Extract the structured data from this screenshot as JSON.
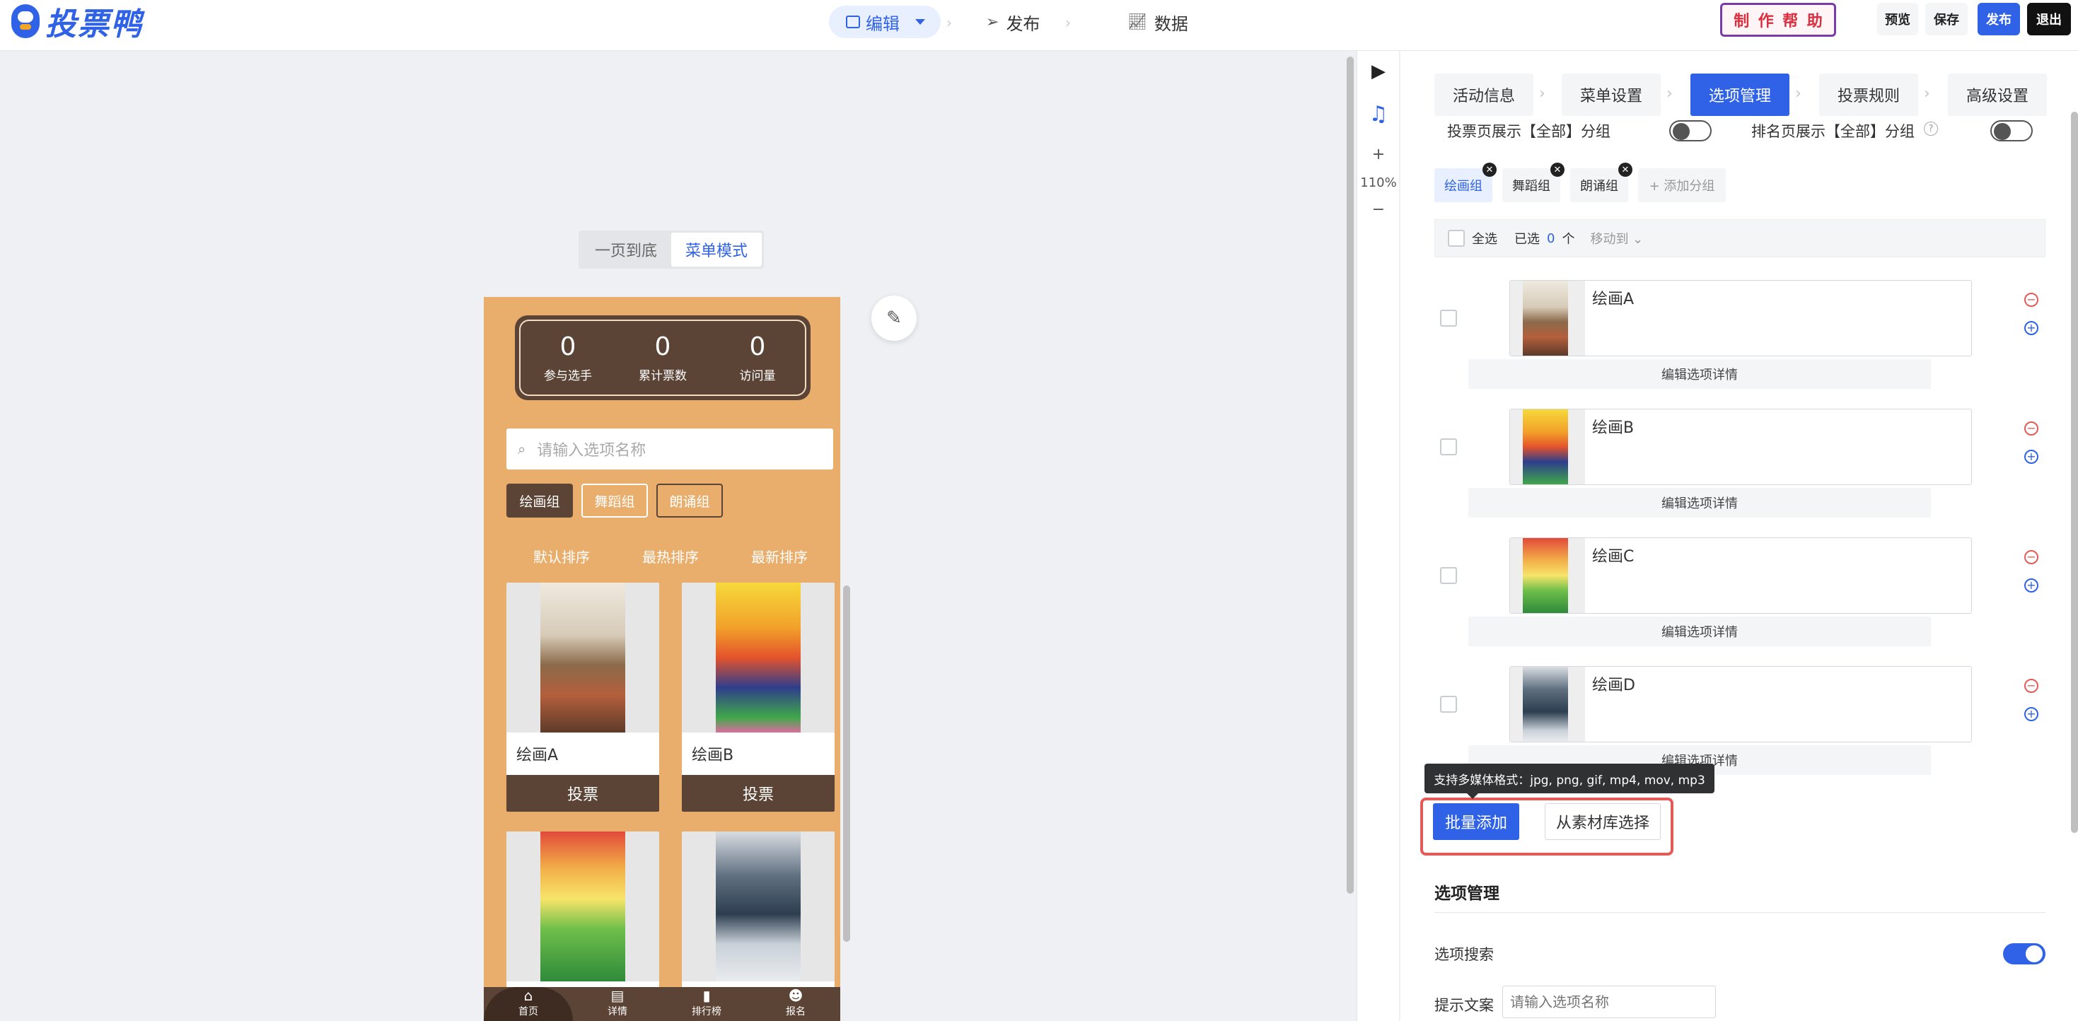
{
  "app": {
    "logo_text": "投票鸭"
  },
  "nav": {
    "edit": "编辑",
    "publish": "发布",
    "data": "数据"
  },
  "stamp": [
    "制",
    "作",
    "帮",
    "助"
  ],
  "actions": {
    "preview": "预览",
    "save": "保存",
    "publish": "发布",
    "exit": "退出"
  },
  "mode_switch": {
    "one_page": "一页到底",
    "menu_mode": "菜单模式"
  },
  "phone": {
    "stats": [
      {
        "value": "0",
        "label": "参与选手"
      },
      {
        "value": "0",
        "label": "累计票数"
      },
      {
        "value": "0",
        "label": "访问量"
      }
    ],
    "search_placeholder": "请输入选项名称",
    "groups": [
      "绘画组",
      "舞蹈组",
      "朗诵组"
    ],
    "sort_tabs": [
      "默认排序",
      "最热排序",
      "最新排序"
    ],
    "cards": [
      {
        "title": "绘画A",
        "vote": "投票"
      },
      {
        "title": "绘画B",
        "vote": "投票"
      },
      {
        "title": "",
        "vote": ""
      },
      {
        "title": "",
        "vote": ""
      }
    ],
    "bottom_nav": [
      "首页",
      "详情",
      "排行榜",
      "报名"
    ]
  },
  "tools": {
    "zoom": "110%",
    "plus": "+",
    "minus": "−"
  },
  "panel": {
    "steps": [
      "活动信息",
      "菜单设置",
      "选项管理",
      "投票规则",
      "高级设置"
    ],
    "toggle1_label": "投票页展示【全部】分组",
    "toggle2_label": "排名页展示【全部】分组",
    "group_tags": [
      "绘画组",
      "舞蹈组",
      "朗诵组"
    ],
    "add_group": "+ 添加分组",
    "toolbar": {
      "select_all": "全选",
      "selected_prefix": "已选",
      "selected_count": "0",
      "selected_suffix": "个",
      "move_to": "移动到"
    },
    "options": [
      {
        "name": "绘画A",
        "edit": "编辑选项详情"
      },
      {
        "name": "绘画B",
        "edit": "编辑选项详情"
      },
      {
        "name": "绘画C",
        "edit": "编辑选项详情"
      },
      {
        "name": "绘画D",
        "edit": "编辑选项详情"
      }
    ],
    "tooltip": "支持多媒体格式：jpg, png, gif, mp4, mov, mp3",
    "batch_add": "批量添加",
    "from_library": "从素材库选择",
    "section_title": "选项管理",
    "search_label": "选项搜索",
    "hint_label": "提示文案",
    "hint_placeholder": "请输入选项名称"
  },
  "colors": {
    "accent": "#2f62e6",
    "phone_bg": "#e9ae6c",
    "phone_dark": "#5b4335",
    "highlight": "#e35b57"
  }
}
